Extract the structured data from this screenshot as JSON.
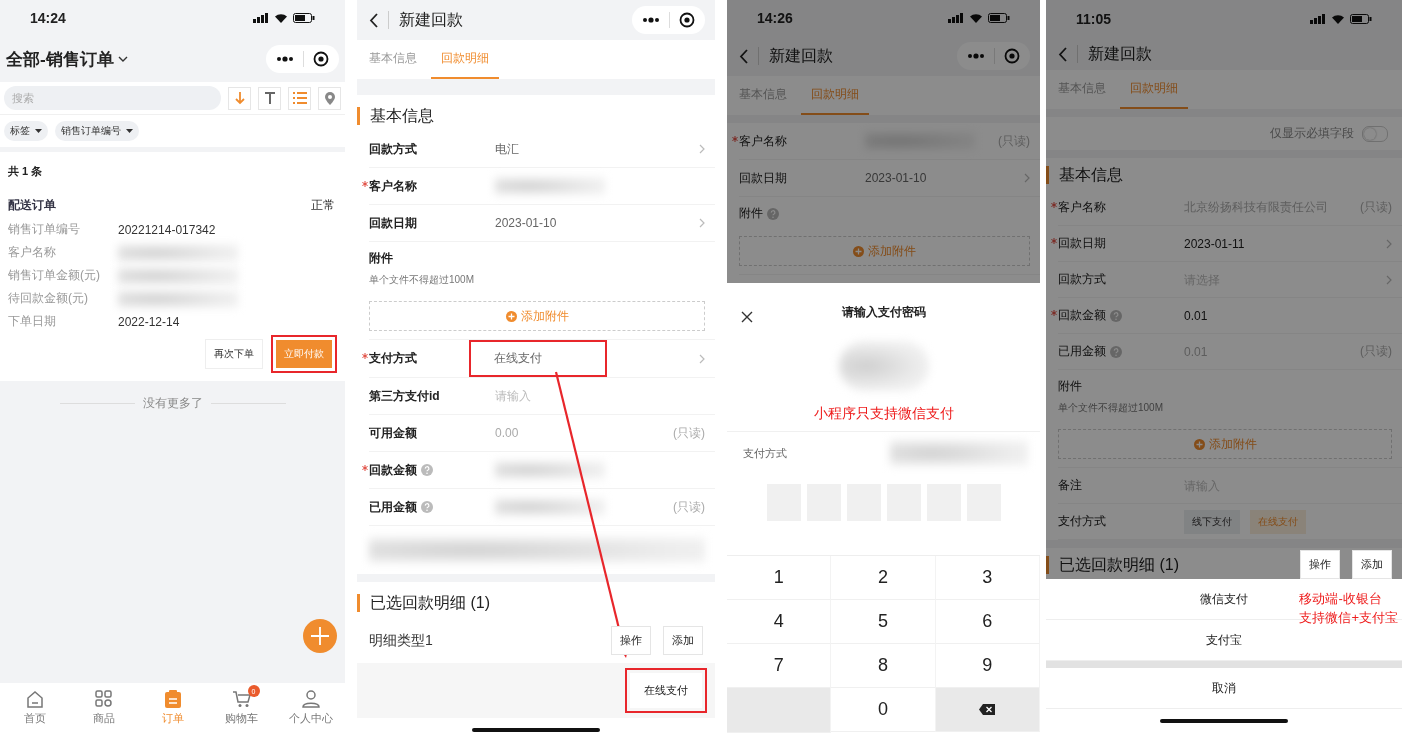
{
  "order_list": {
    "time": "14:24",
    "title": "全部-销售订单",
    "search_placeholder": "搜索",
    "filters": [
      {
        "label": "标签"
      },
      {
        "label": "销售订单编号"
      }
    ],
    "count": "共 1 条",
    "order": {
      "type": "配送订单",
      "status": "正常",
      "fields": [
        {
          "label": "销售订单编号",
          "value": "20221214-017342"
        },
        {
          "label": "客户名称",
          "redacted": true
        },
        {
          "label": "销售订单金额(元)",
          "redacted": true
        },
        {
          "label": "待回款金额(元)",
          "redacted": true
        },
        {
          "label": "下单日期",
          "value": "2022-12-14"
        }
      ],
      "actions": [
        {
          "label": "再次下单",
          "kind": "secondary"
        },
        {
          "label": "立即付款",
          "kind": "primary",
          "highlighted": true
        }
      ]
    },
    "end_text": "没有更多了",
    "nav": [
      {
        "label": "首页",
        "selected": false
      },
      {
        "label": "商品",
        "selected": false
      },
      {
        "label": "订单",
        "selected": true
      },
      {
        "label": "购物车",
        "selected": false,
        "badge": "0"
      },
      {
        "label": "个人中心",
        "selected": false
      }
    ]
  },
  "payment_form": {
    "title": "新建回款",
    "tabs": [
      {
        "label": "基本信息",
        "selected": false
      },
      {
        "label": "回款明细",
        "selected": true
      }
    ],
    "section": "基本信息",
    "rows": [
      {
        "kind": "field",
        "label": "回款方式",
        "value": "电汇",
        "chevron": true
      },
      {
        "kind": "field",
        "label": "客户名称",
        "required": true,
        "redacted": true
      },
      {
        "kind": "field",
        "label": "回款日期",
        "value": "2023-01-10",
        "chevron": true
      },
      {
        "kind": "attachment",
        "label": "附件",
        "hint": "单个文件不得超过100M",
        "button": "添加附件"
      },
      {
        "kind": "field",
        "label": "支付方式",
        "required": true,
        "value": "在线支付",
        "chevron": true,
        "highlighted": true
      },
      {
        "kind": "field",
        "label": "第三方支付id",
        "placeholder": "请输入"
      },
      {
        "kind": "field",
        "label": "可用金额",
        "value": "0.00",
        "readonly": "(只读)"
      },
      {
        "kind": "field",
        "label": "回款金额",
        "required": true,
        "help": true,
        "redacted": true
      },
      {
        "kind": "field",
        "label": "已用金额",
        "help": true,
        "readonly": "(只读)",
        "redacted": true
      },
      {
        "kind": "redacted"
      }
    ],
    "detail": {
      "title": "已选回款明细 (1)",
      "item": "明细类型1",
      "buttons": [
        "操作",
        "添加"
      ]
    },
    "submit": {
      "label": "在线支付",
      "highlighted": true
    }
  },
  "password_sheet": {
    "time": "14:26",
    "title": "新建回款",
    "tabs": [
      {
        "label": "基本信息",
        "selected": false
      },
      {
        "label": "回款明细",
        "selected": true
      }
    ],
    "rows": [
      {
        "kind": "field",
        "label": "客户名称",
        "required": true,
        "readonly": "(只读)",
        "redacted": true
      },
      {
        "kind": "field",
        "label": "回款日期",
        "value": "2023-01-10",
        "chevron": true
      },
      {
        "kind": "attachment",
        "label": "附件",
        "help": true,
        "button": "添加附件"
      }
    ],
    "sheet": {
      "title": "请输入支付密码",
      "note": "小程序只支持微信支付",
      "method_label": "支付方式",
      "boxes": [
        {
          "filled": false
        },
        {
          "filled": false
        },
        {
          "filled": false
        },
        {
          "filled": false
        },
        {
          "filled": false
        },
        {
          "filled": false
        }
      ],
      "keys": [
        {
          "kind": "digit",
          "label": "1"
        },
        {
          "kind": "digit",
          "label": "2"
        },
        {
          "kind": "digit",
          "label": "3"
        },
        {
          "kind": "digit",
          "label": "4"
        },
        {
          "kind": "digit",
          "label": "5"
        },
        {
          "kind": "digit",
          "label": "6"
        },
        {
          "kind": "digit",
          "label": "7"
        },
        {
          "kind": "digit",
          "label": "8"
        },
        {
          "kind": "digit",
          "label": "9"
        },
        {
          "kind": "blank"
        },
        {
          "kind": "digit",
          "label": "0"
        },
        {
          "kind": "delete"
        }
      ]
    }
  },
  "cashier": {
    "time": "11:05",
    "title": "新建回款",
    "tabs": [
      {
        "label": "基本信息",
        "selected": false
      },
      {
        "label": "回款明细",
        "selected": true
      }
    ],
    "required_only": {
      "label": "仅显示必填字段",
      "on": false
    },
    "section": "基本信息",
    "rows": [
      {
        "kind": "field",
        "label": "客户名称",
        "required": true,
        "value": "北京纷扬科技有限责任公司",
        "readonly": "(只读)"
      },
      {
        "kind": "field",
        "label": "回款日期",
        "required": true,
        "value": "2023-01-11",
        "chevron": true
      },
      {
        "kind": "field",
        "label": "回款方式",
        "placeholder": "请选择",
        "chevron": true
      },
      {
        "kind": "field",
        "label": "回款金额",
        "required": true,
        "help": true,
        "value": "0.01"
      },
      {
        "kind": "field",
        "label": "已用金额",
        "help": true,
        "value": "0.01",
        "readonly": "(只读)"
      },
      {
        "kind": "attachment",
        "label": "附件",
        "hint": "单个文件不得超过100M",
        "button": "添加附件"
      },
      {
        "kind": "field",
        "label": "备注",
        "placeholder": "请输入"
      },
      {
        "kind": "chips",
        "label": "支付方式",
        "options": [
          {
            "label": "线下支付",
            "selected": false
          },
          {
            "label": "在线支付",
            "selected": true
          }
        ]
      }
    ],
    "detail": {
      "title": "已选回款明细 (1)",
      "buttons": [
        "操作",
        "添加"
      ]
    },
    "sheet": {
      "options": [
        {
          "label": "微信支付"
        },
        {
          "label": "支付宝"
        }
      ],
      "cancel": "取消",
      "note": [
        "移动端-收银台",
        "支持微信+支付宝"
      ]
    }
  }
}
